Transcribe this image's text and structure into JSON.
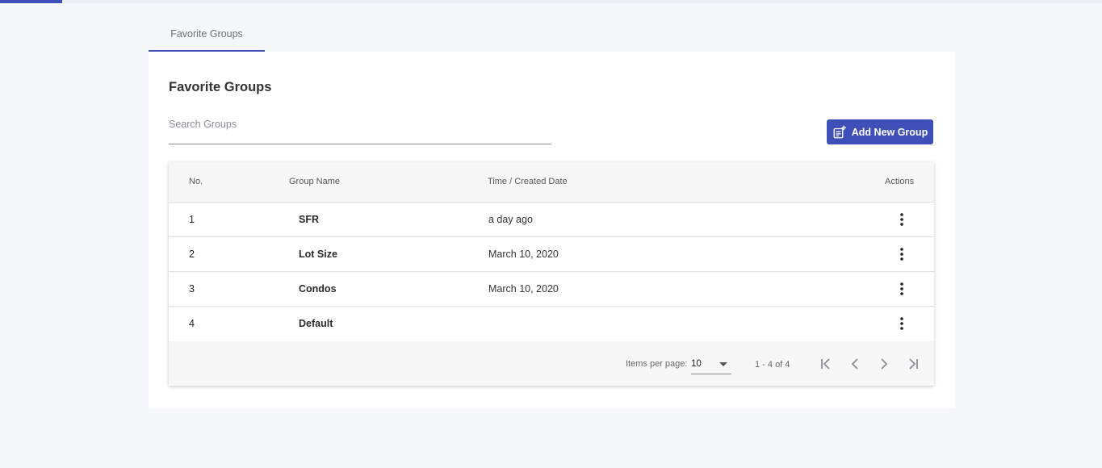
{
  "tabs": [
    {
      "label": "Favorite Groups",
      "active": true
    }
  ],
  "page": {
    "title": "Favorite Groups"
  },
  "search": {
    "placeholder": "Search Groups",
    "value": ""
  },
  "toolbar": {
    "add_label": "Add New Group",
    "add_icon": "playlist-add-icon"
  },
  "table": {
    "columns": [
      "No.",
      "Group Name",
      "Time / Created Date",
      "Actions"
    ],
    "rows": [
      {
        "no": "1",
        "name": "SFR",
        "date": "a day ago"
      },
      {
        "no": "2",
        "name": "Lot Size",
        "date": "March 10, 2020"
      },
      {
        "no": "3",
        "name": "Condos",
        "date": "March 10, 2020"
      },
      {
        "no": "4",
        "name": "Default",
        "date": ""
      }
    ],
    "row_action_icon": "more-vertical-icon"
  },
  "paginator": {
    "items_per_page_label": "Items per page:",
    "items_per_page_value": "10",
    "range_label": "1 - 4 of 4"
  },
  "colors": {
    "accent": "#3f4fb8",
    "background": "#f6f7fb",
    "panel": "#ffffff"
  }
}
